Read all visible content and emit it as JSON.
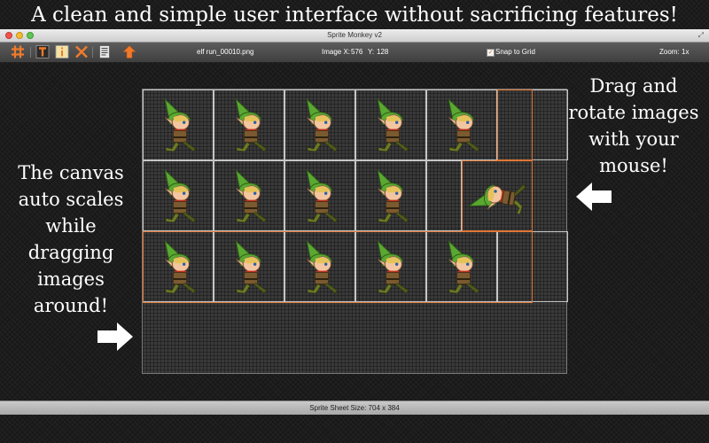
{
  "headline": "A clean and simple user interface without sacrificing features!",
  "note_left": "The canvas auto scales while dragging images around!",
  "note_right": "Drag and rotate images with your mouse!",
  "window": {
    "title": "Sprite Monkey v2"
  },
  "toolbar": {
    "tools": [
      "grid-icon",
      "text-tool-icon",
      "info-icon",
      "delete-icon",
      "document-icon",
      "export-arrow-icon"
    ],
    "file_name": "elf run_00010.png",
    "image_x_label": "Image X:",
    "image_x": "576",
    "image_y_label": "Y:",
    "image_y": "128",
    "snap_label": "Snap to Grid",
    "snap_checked": true,
    "zoom_label": "Zoom:",
    "zoom": "1x"
  },
  "status": {
    "sheet_size": "Sprite Sheet Size: 704 x 384"
  },
  "colors": {
    "accent": "#e07633",
    "sprite_hat": "#5aa831",
    "selection": "#e07633"
  }
}
